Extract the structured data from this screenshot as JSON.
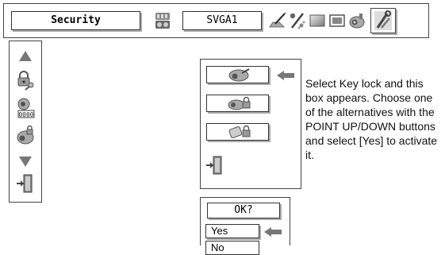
{
  "toolbar": {
    "title": "Security",
    "mode": "SVGA1",
    "icons": [
      "input-select-icon",
      "pc-adjust-icon",
      "image-select-icon",
      "image-adjust-icon",
      "screen-icon",
      "setting-icon",
      "tools-icon"
    ]
  },
  "sidebar": {
    "items": [
      "up-arrow-icon",
      "key-lock-icon",
      "pin-code-lock-icon",
      "projector-lock-icon",
      "down-arrow-icon",
      "exit-icon"
    ]
  },
  "keylock": {
    "options": [
      "unlock-projector-icon",
      "lock-projector-icon",
      "lock-remote-icon"
    ],
    "selected_index": 0,
    "exit": "exit-icon"
  },
  "instructions": "Select Key lock and this box appears. Choose one of the alternatives with the POINT UP/DOWN buttons and select [Yes] to activate it.",
  "confirm": {
    "prompt": "OK?",
    "yes": "Yes",
    "no": "No",
    "selected": "Yes"
  },
  "colors": {
    "border": "#444444",
    "shadow": "#aaaaaa",
    "arrow": "#777777"
  }
}
